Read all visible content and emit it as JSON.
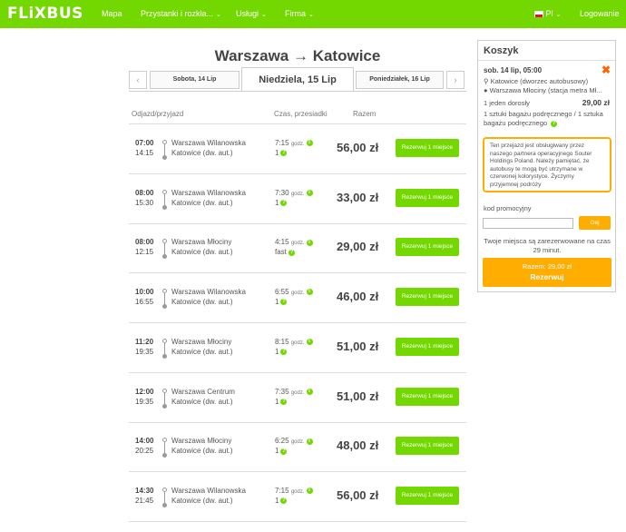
{
  "header": {
    "logo": "FLiXBUS",
    "nav": [
      "Mapa",
      "Przystanki i rozkła...",
      "Usługi",
      "Firma"
    ],
    "language": "Pl",
    "login": "Logowanie",
    "chevron": "⌄"
  },
  "search": {
    "title": "Warszawa → Katowice",
    "prev_arrow": "‹",
    "next_arrow": "›",
    "prev_day": "Sobota, 14 Lip",
    "current_day": "Niedziela, 15 Lip",
    "next_day": "Poniedziałek, 16 Lip"
  },
  "columns": {
    "depart": "Odjazd/przyjazd",
    "duration": "Czas, przesiadki",
    "total": "Razem"
  },
  "rows": [
    {
      "dep": "07:00",
      "arr": "14:15",
      "from": "Warszawa Wilanowska",
      "to": "Katowice (dw. aut.)",
      "duration": "7:15",
      "unit": "godz.",
      "transfers": "1",
      "price": "56,00 zł",
      "button": "Rezerwuj 1 miejsce"
    },
    {
      "dep": "08:00",
      "arr": "15:30",
      "from": "Warszawa Wilanowska",
      "to": "Katowice (dw. aut.)",
      "duration": "7:30",
      "unit": "godz.",
      "transfers": "1",
      "price": "33,00 zł",
      "button": "Rezerwuj 1 miejsce"
    },
    {
      "dep": "08:00",
      "arr": "12:15",
      "from": "Warszawa Młociny",
      "to": "Katowice (dw. aut.)",
      "duration": "4:15",
      "unit": "godz.",
      "transfers": "fast",
      "price": "29,00 zł",
      "button": "Rezerwuj 1 miejsce"
    },
    {
      "dep": "10:00",
      "arr": "16:55",
      "from": "Warszawa Wilanowska",
      "to": "Katowice (dw. aut.)",
      "duration": "6:55",
      "unit": "godz.",
      "transfers": "1",
      "price": "46,00 zł",
      "button": "Rezerwuj 1 miejsce"
    },
    {
      "dep": "11:20",
      "arr": "19:35",
      "from": "Warszawa Młociny",
      "to": "Katowice (dw. aut.)",
      "duration": "8:15",
      "unit": "godz.",
      "transfers": "1",
      "price": "51,00 zł",
      "button": "Rezerwuj 1 miejsce"
    },
    {
      "dep": "12:00",
      "arr": "19:35",
      "from": "Warszawa Centrum",
      "to": "Katowice (dw. aut.)",
      "duration": "7:35",
      "unit": "godz.",
      "transfers": "1",
      "price": "51,00 zł",
      "button": "Rezerwuj 1 miejsce"
    },
    {
      "dep": "14:00",
      "arr": "20:25",
      "from": "Warszawa Młociny",
      "to": "Katowice (dw. aut.)",
      "duration": "6:25",
      "unit": "godz.",
      "transfers": "1",
      "price": "48,00 zł",
      "button": "Rezerwuj 1 miejsce"
    },
    {
      "dep": "14:30",
      "arr": "21:45",
      "from": "Warszawa Wilanowska",
      "to": "Katowice (dw. aut.)",
      "duration": "7:15",
      "unit": "godz.",
      "transfers": "1",
      "price": "56,00 zł",
      "button": "Rezerwuj 1 miejsce"
    }
  ],
  "cart": {
    "title": "Koszyk",
    "date": "sob. 14 lip, 05:00",
    "remove": "✖",
    "stop_from": "Katowice (dworzec autobusowy)",
    "stop_to": "Warszawa Młociny (stacja metra Mł...",
    "passengers": "1 jeden dorosły",
    "price": "29,00 zł",
    "baggage": "1 sztuki bagażu podręcznego / 1 sztuka bagażu podręcznego",
    "info": "Ten przejazd jest obsługiwany przez naszego partnera operacyjnego Souter Holdings Poland. Należy pamiętać, że autobusy te mogą być utrzymane w czerwonej kolorystyce. Życzymy przyjemnej podróży",
    "promo_label": "kod promocyjny",
    "promo_value": "",
    "promo_button": "Gej",
    "reserved": "Twoje miejsca są zarezerwowane na czas 29 minut.",
    "total": "Razem: 29,00 zł",
    "pay": "Rezerwuj"
  },
  "colors": {
    "brand": "#73d700",
    "accent": "#ffad00",
    "remove": "#ff6600"
  },
  "icons": [
    "stop-pin-icon",
    "info-icon",
    "close-icon",
    "flag-icon",
    "chevron-down-icon"
  ]
}
